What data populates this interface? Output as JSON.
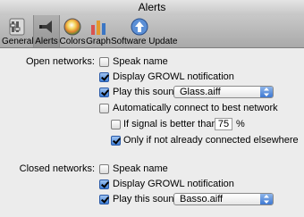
{
  "window": {
    "title": "Alerts"
  },
  "toolbar": {
    "items": [
      {
        "label": "General",
        "icon": "general-icon"
      },
      {
        "label": "Alerts",
        "icon": "alerts-icon",
        "selected": true
      },
      {
        "label": "Colors",
        "icon": "colors-icon"
      },
      {
        "label": "Graph",
        "icon": "graph-icon"
      },
      {
        "label": "Software Update",
        "icon": "software-update-icon"
      }
    ]
  },
  "open_networks": {
    "label": "Open networks:",
    "speak_name": {
      "label": "Speak name",
      "checked": false
    },
    "display_growl": {
      "label": "Display GROWL notification",
      "checked": true
    },
    "play_sound": {
      "label": "Play this sound:",
      "checked": true,
      "value": "Glass.aiff"
    },
    "auto_connect": {
      "label": "Automatically connect to best network",
      "checked": false
    },
    "signal_better": {
      "label": "If signal is better than:",
      "checked": false,
      "value": "75",
      "unit": "%"
    },
    "only_if_not_connected": {
      "label": "Only if not already connected elsewhere",
      "checked": true
    }
  },
  "closed_networks": {
    "label": "Closed networks:",
    "speak_name": {
      "label": "Speak name",
      "checked": false
    },
    "display_growl": {
      "label": "Display GROWL notification",
      "checked": true
    },
    "play_sound": {
      "label": "Play this sound:",
      "checked": true,
      "value": "Basso.aiff"
    }
  },
  "colors": {
    "accent": "#3f7fd6",
    "window_bg": "#ececec",
    "toolbar_bg": "#b9b9b9"
  }
}
